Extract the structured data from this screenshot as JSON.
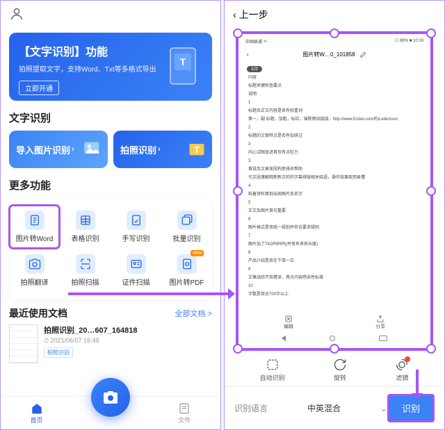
{
  "left": {
    "promo": {
      "title": "【文字识别】功能",
      "subtitle": "拍照提取文字，支持Word、Txt等多格式导出",
      "button": "立即开通"
    },
    "section1_title": "文字识别",
    "cards": {
      "import": "导入图片识别",
      "shoot": "拍照识别"
    },
    "section2_title": "更多功能",
    "grid": [
      {
        "label": "图片转Word",
        "icon": "doc",
        "hl": true
      },
      {
        "label": "表格识别",
        "icon": "table"
      },
      {
        "label": "手写识别",
        "icon": "handwrite"
      },
      {
        "label": "批量识别",
        "icon": "batch"
      },
      {
        "label": "拍照翻译",
        "icon": "camera"
      },
      {
        "label": "拍照扫描",
        "icon": "scan"
      },
      {
        "label": "证件扫描",
        "icon": "idcard"
      },
      {
        "label": "图片转PDF",
        "icon": "pdf",
        "badge": "new"
      }
    ],
    "recent": {
      "title": "最近使用文档",
      "all": "全部文档 >",
      "doc": {
        "name": "拍照识别_20…607_164818",
        "time": "2021/06/07 16:48",
        "tag": "拍照识别"
      }
    },
    "nav": {
      "home": "首页",
      "files": "文件"
    }
  },
  "right": {
    "back": "上一步",
    "preview": {
      "status_left": "中国联通 ⁴ᴳ",
      "status_right": "☐ 88% ■ 10:19",
      "title": "图片转W…0_101858",
      "page": "1/2",
      "lines": [
        "内容",
        "标题关键检查要点",
        "说明",
        "1",
        "标题及正文内容是否有权重词",
        "第一，副 标题，加粗，标红，锚新网站链接，http://www.51dxo.com的d.edu/xxxx",
        "2",
        "标题的文案特点是否有钻研过",
        "3",
        "内心试图放进首页有点吃力",
        "3",
        "首段及文章发段构思排名帮助",
        "引文段落解释新新正的的字幕排版相关结语，操作效果取而易懂",
        "4",
        "粘着资料策划出现图片及名字",
        "5",
        "正文及图片首句重要",
        "6",
        "图片格式是否统一规划并符合要求规则",
        "7",
        "图片加了TKD吗吗吗(并发有来有长度)",
        "8",
        "产品介绍是否在下单一位",
        "9",
        "文章战综不否精深，具光内容感染性标准",
        "10",
        "字数是否达700字以上"
      ],
      "footer": {
        "edit": "编辑",
        "share": "分享"
      }
    },
    "tools": {
      "auto": "自动识别",
      "rotate": "旋转",
      "filter": "滤镜"
    },
    "lang_label": "识别语言",
    "lang_value": "中英混合",
    "recognize": "识别"
  }
}
